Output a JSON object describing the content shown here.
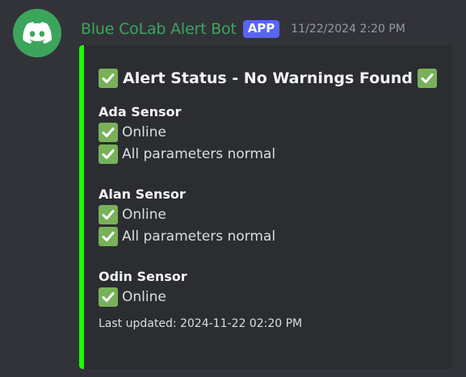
{
  "bot": {
    "username": "Blue CoLab Alert Bot",
    "badge": "APP",
    "timestamp": "11/22/2024 2:20 PM",
    "avatar_icon": "discord-logo-icon",
    "name_color": "#3ba55c"
  },
  "embed": {
    "accent_color": "#1aff00",
    "title": "Alert Status - No Warnings Found",
    "fields": [
      {
        "name": "Ada Sensor",
        "lines": [
          "Online",
          "All parameters normal"
        ]
      },
      {
        "name": "Alan Sensor",
        "lines": [
          "Online",
          "All parameters normal"
        ]
      },
      {
        "name": "Odin Sensor",
        "lines": [
          "Online"
        ]
      }
    ],
    "footer": "Last updated: 2024-11-22 02:20 PM",
    "check_icon": "check-mark-icon"
  }
}
